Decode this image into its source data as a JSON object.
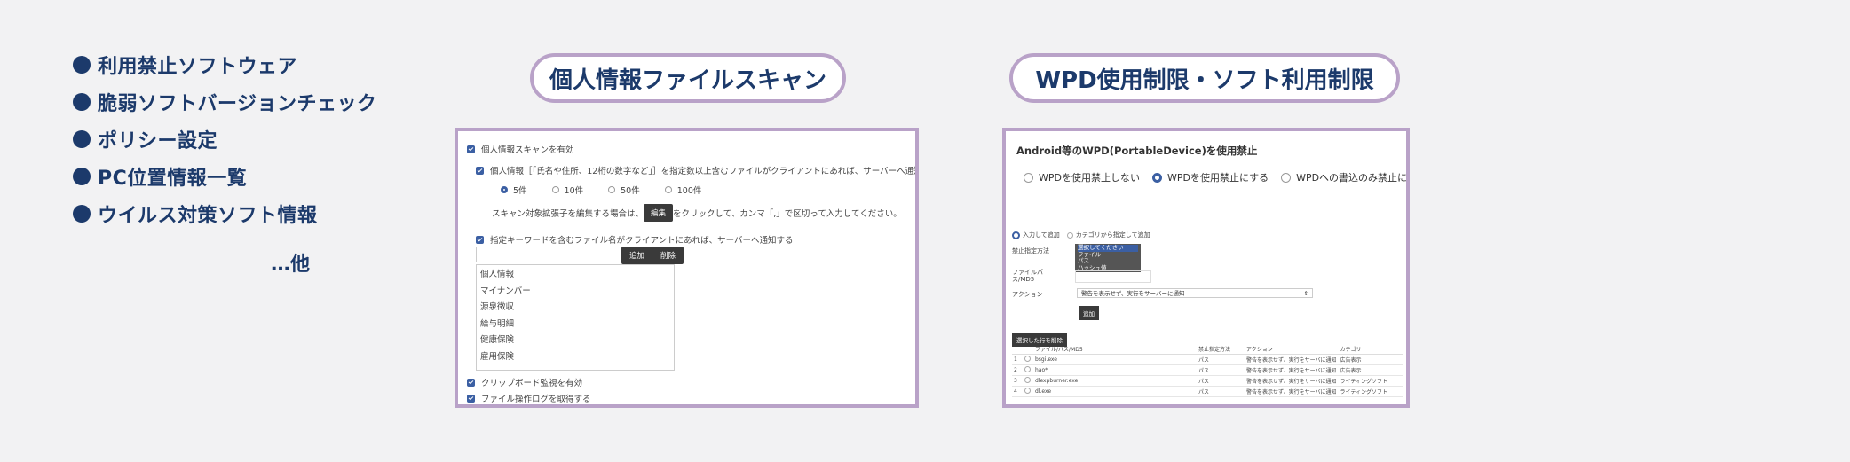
{
  "features": {
    "items": [
      "利用禁止ソフトウェア",
      "脆弱ソフトバージョンチェック",
      "ポリシー設定",
      "PC位置情報一覧",
      "ウイルス対策ソフト情報"
    ],
    "others": "…他"
  },
  "titles": {
    "personal_scan": "個人情報ファイルスキャン",
    "wpd": "WPD使用制限・ソフト利用制限"
  },
  "scan_panel": {
    "enable_label": "個人情報スキャンを有効",
    "personal_info_label": "個人情報［「氏名や住所、12桁の数字など」］を指定数以上含むファイルがクライアントにあれば、サーバーへ通知する",
    "count_options": [
      "5件",
      "10件",
      "50件",
      "100件"
    ],
    "count_selected_index": 0,
    "ext_note_before": "スキャン対象拡張子を編集する場合は、",
    "edit_button": "編集",
    "ext_note_after": "をクリックして、カンマ「,」で区切って入力してください。",
    "keyword_label": "指定キーワードを含むファイル名がクライアントにあれば、サーバーへ通知する",
    "add_button": "追加",
    "delete_button": "削除",
    "keywords": [
      "個人情報",
      "マイナンバー",
      "源泉徴収",
      "給与明細",
      "健康保険",
      "雇用保険"
    ],
    "clipboard_label": "クリップボード監視を有効",
    "file_log_label": "ファイル操作ログを取得する"
  },
  "wpd_panel": {
    "title": "Android等のWPD(PortableDevice)を使用禁止",
    "options": [
      "WPDを使用禁止しない",
      "WPDを使用禁止にする",
      "WPDへの書込のみ禁止にする"
    ],
    "selected_index": 1,
    "add_mode_options": [
      "入力して追加",
      "カテゴリから指定して追加"
    ],
    "method_label": "禁止指定方法",
    "method_options": [
      "選択してください",
      "ファイル",
      "パス",
      "ハッシュ値"
    ],
    "path_label": "ファイルパス/MD5",
    "action_label": "アクション",
    "action_value": "警告を表示せず、実行をサーバーに通知",
    "add_button": "追加",
    "delete_selected_button": "選択した行を削除",
    "table": {
      "headers": [
        "",
        "",
        "ファイル/パス/MD5",
        "禁止指定方法",
        "アクション",
        "カテゴリ"
      ],
      "rows": [
        [
          "1",
          "",
          "bsgi.exe",
          "パス",
          "警告を表示せず、実行をサーバに通知",
          "広告表示"
        ],
        [
          "2",
          "",
          "hao*",
          "パス",
          "警告を表示せず、実行をサーバに通知",
          "広告表示"
        ],
        [
          "3",
          "",
          "dlexpburner.exe",
          "パス",
          "警告を表示せず、実行をサーバに通知",
          "ライティングソフト"
        ],
        [
          "4",
          "",
          "dl.exe",
          "パス",
          "警告を表示せず、実行をサーバに通知",
          "ライティングソフト"
        ]
      ]
    }
  }
}
